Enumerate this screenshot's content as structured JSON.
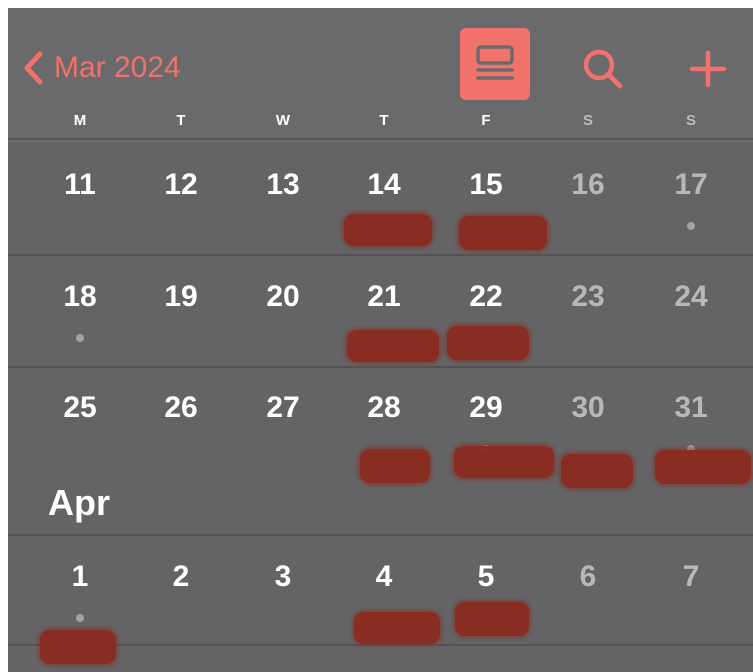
{
  "header": {
    "back_label": "Mar 2024",
    "accent_color": "#f0726a",
    "icons": [
      "chevron-left-icon",
      "list-view-icon",
      "search-icon",
      "plus-icon"
    ]
  },
  "weekdays": [
    "M",
    "T",
    "W",
    "T",
    "F",
    "S",
    "S"
  ],
  "weeks": [
    {
      "days": [
        "11",
        "12",
        "13",
        "14",
        "15",
        "16",
        "17"
      ]
    },
    {
      "days": [
        "18",
        "19",
        "20",
        "21",
        "22",
        "23",
        "24"
      ]
    },
    {
      "days": [
        "25",
        "26",
        "27",
        "28",
        "29",
        "30",
        "31"
      ]
    },
    {
      "month_label": "Apr",
      "days": [
        "1",
        "2",
        "3",
        "4",
        "5",
        "6",
        "7"
      ]
    }
  ],
  "event_dots": [
    "17",
    "18",
    "29",
    "31",
    "1"
  ]
}
